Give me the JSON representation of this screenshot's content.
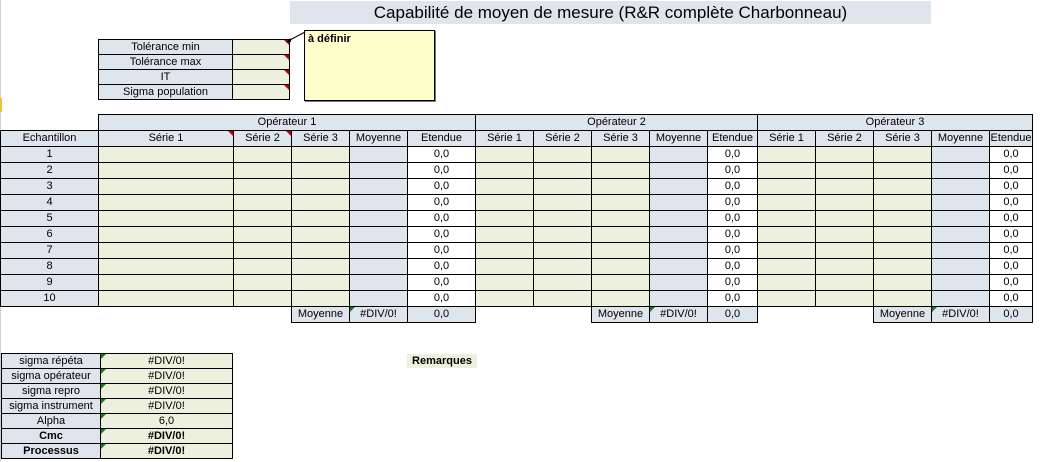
{
  "title": "Capabilité de moyen de mesure (R&R complète Charbonneau)",
  "params": [
    {
      "label": "Tolérance min",
      "value": ""
    },
    {
      "label": "Tolérance max",
      "value": ""
    },
    {
      "label": "IT",
      "value": ""
    },
    {
      "label": "Sigma population",
      "value": ""
    }
  ],
  "comment_text": "à définir",
  "operators": [
    "Opérateur 1",
    "Opérateur 2",
    "Opérateur 3"
  ],
  "sample_header": "Echantillon",
  "col_headers": [
    "Série 1",
    "Série 2",
    "Série 3",
    "Moyenne",
    "Etendue"
  ],
  "samples": [
    "1",
    "2",
    "3",
    "4",
    "5",
    "6",
    "7",
    "8",
    "9",
    "10"
  ],
  "range_value": "0,0",
  "footer": {
    "label": "Moyenne",
    "mean": "#DIV/0!",
    "range": "0,0"
  },
  "results": [
    {
      "label": "sigma répéta",
      "value": "#DIV/0!",
      "bold": false
    },
    {
      "label": "sigma opérateur",
      "value": "#DIV/0!",
      "bold": false
    },
    {
      "label": "sigma repro",
      "value": "#DIV/0!",
      "bold": false
    },
    {
      "label": "sigma instrument",
      "value": "#DIV/0!",
      "bold": false
    },
    {
      "label": "Alpha",
      "value": "6,0",
      "bold": false
    },
    {
      "label": "Cmc",
      "value": "#DIV/0!",
      "bold": true
    },
    {
      "label": "Processus",
      "value": "#DIV/0!",
      "bold": true
    }
  ],
  "remarks_label": "Remarques"
}
